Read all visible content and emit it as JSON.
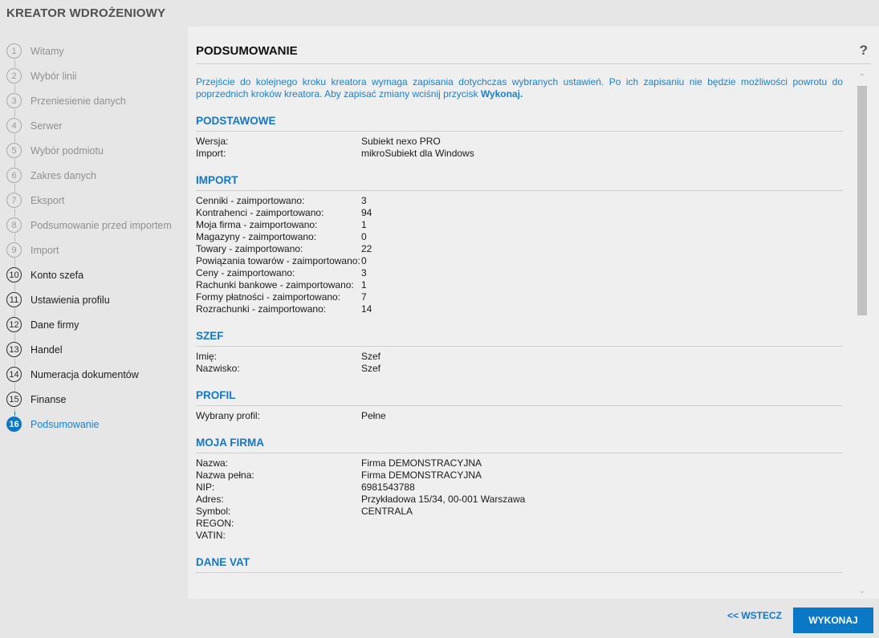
{
  "app": {
    "title": "KREATOR WDROŻENIOWY"
  },
  "steps": [
    {
      "num": "1",
      "label": "Witamy",
      "state": "pending"
    },
    {
      "num": "2",
      "label": "Wybór linii",
      "state": "pending"
    },
    {
      "num": "3",
      "label": "Przeniesienie danych",
      "state": "pending"
    },
    {
      "num": "4",
      "label": "Serwer",
      "state": "pending"
    },
    {
      "num": "5",
      "label": "Wybór podmiotu",
      "state": "pending"
    },
    {
      "num": "6",
      "label": "Zakres danych",
      "state": "pending"
    },
    {
      "num": "7",
      "label": "Eksport",
      "state": "pending"
    },
    {
      "num": "8",
      "label": "Podsumowanie przed importem",
      "state": "pending"
    },
    {
      "num": "9",
      "label": "Import",
      "state": "pending"
    },
    {
      "num": "10",
      "label": "Konto szefa",
      "state": "done"
    },
    {
      "num": "11",
      "label": "Ustawienia profilu",
      "state": "done"
    },
    {
      "num": "12",
      "label": "Dane firmy",
      "state": "done"
    },
    {
      "num": "13",
      "label": "Handel",
      "state": "done"
    },
    {
      "num": "14",
      "label": "Numeracja dokumentów",
      "state": "done"
    },
    {
      "num": "15",
      "label": "Finanse",
      "state": "done"
    },
    {
      "num": "16",
      "label": "Podsumowanie",
      "state": "active"
    }
  ],
  "panel": {
    "title": "PODSUMOWANIE",
    "help": "?",
    "intro_text": "Przejście do kolejnego kroku kreatora wymaga zapisania dotychczas wybranych ustawień. Po ich zapisaniu nie będzie możliwości powrotu do poprzednich kroków kreatora. Aby zapisać zmiany wciśnij przycisk ",
    "intro_bold": "Wykonaj.",
    "sections": [
      {
        "title": "PODSTAWOWE",
        "rows": [
          {
            "k": "Wersja:",
            "v": "Subiekt nexo PRO"
          },
          {
            "k": "Import:",
            "v": "mikroSubiekt dla Windows"
          }
        ]
      },
      {
        "title": "IMPORT",
        "rows": [
          {
            "k": "Cenniki - zaimportowano:",
            "v": "3"
          },
          {
            "k": "Kontrahenci - zaimportowano:",
            "v": "94"
          },
          {
            "k": "Moja firma - zaimportowano:",
            "v": "1"
          },
          {
            "k": "Magazyny - zaimportowano:",
            "v": "0"
          },
          {
            "k": "Towary - zaimportowano:",
            "v": "22"
          },
          {
            "k": "Powiązania towarów - zaimportowano:",
            "v": "0"
          },
          {
            "k": "Ceny - zaimportowano:",
            "v": "3"
          },
          {
            "k": "Rachunki bankowe - zaimportowano:",
            "v": "1"
          },
          {
            "k": "Formy płatności - zaimportowano:",
            "v": "7"
          },
          {
            "k": "Rozrachunki - zaimportowano:",
            "v": "14"
          }
        ]
      },
      {
        "title": "SZEF",
        "rows": [
          {
            "k": "Imię:",
            "v": "Szef"
          },
          {
            "k": "Nazwisko:",
            "v": "Szef"
          }
        ]
      },
      {
        "title": "PROFIL",
        "rows": [
          {
            "k": "Wybrany profil:",
            "v": "Pełne"
          }
        ]
      },
      {
        "title": "MOJA FIRMA",
        "rows": [
          {
            "k": "Nazwa:",
            "v": "Firma DEMONSTRACYJNA"
          },
          {
            "k": "Nazwa pełna:",
            "v": "Firma DEMONSTRACYJNA"
          },
          {
            "k": "NIP:",
            "v": "6981543788"
          },
          {
            "k": "Adres:",
            "v": "Przykładowa 15/34, 00-001 Warszawa"
          },
          {
            "k": "Symbol:",
            "v": "CENTRALA"
          },
          {
            "k": "REGON:",
            "v": ""
          },
          {
            "k": "VATIN:",
            "v": ""
          }
        ]
      },
      {
        "title": "DANE VAT",
        "rows": []
      }
    ]
  },
  "buttons": {
    "back": "<< WSTECZ",
    "execute": "WYKONAJ"
  },
  "colors": {
    "accent": "#0b78c5",
    "heading": "#1677c9",
    "background": "#e6e6e6",
    "panel": "#efefef"
  }
}
